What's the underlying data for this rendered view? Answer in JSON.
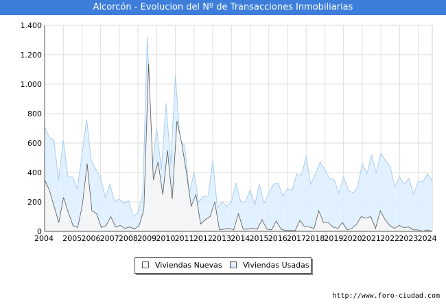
{
  "chart_data": {
    "type": "area",
    "title": "Alcorcón - Evolucion del Nº de Transacciones Inmobiliarias",
    "xlabel": "",
    "ylabel": "",
    "ylim": [
      0,
      1400
    ],
    "yticks": [
      0,
      200,
      400,
      600,
      800,
      1000,
      1200,
      1400
    ],
    "ytick_labels": [
      "0",
      "200",
      "400",
      "600",
      "800",
      "1.000",
      "1.200",
      "1.400"
    ],
    "xlim": [
      2004,
      2024.75
    ],
    "xticks": [
      2004,
      2005,
      2006,
      2007,
      2008,
      2009,
      2010,
      2011,
      2012,
      2013,
      2014,
      2015,
      2016,
      2017,
      2018,
      2019,
      2020,
      2021,
      2022,
      2023,
      2024
    ],
    "xtick_labels": [
      "2004",
      "2005",
      "2006",
      "2007",
      "2008",
      "2009",
      "2010",
      "2011",
      "2012",
      "2013",
      "2014",
      "2015",
      "2016",
      "2017",
      "2018",
      "2019",
      "2020",
      "2021",
      "2022",
      "2023",
      "2024"
    ],
    "grid": true,
    "legend_position": "bottom-center",
    "colors": {
      "nuevas_fill": "#f5f5f5",
      "usadas_fill": "#ddeeff",
      "nuevas_line": "#555555",
      "usadas_line": "#a8cdee",
      "grid": "#dddddd"
    },
    "series": [
      {
        "name": "Viviendas Nuevas",
        "values": [
          350,
          280,
          170,
          60,
          230,
          130,
          40,
          25,
          180,
          460,
          140,
          120,
          25,
          40,
          100,
          30,
          40,
          20,
          30,
          15,
          40,
          150,
          1140,
          350,
          470,
          250,
          550,
          220,
          750,
          600,
          400,
          170,
          250,
          50,
          80,
          100,
          200,
          10,
          15,
          20,
          10,
          120,
          15,
          15,
          20,
          15,
          80,
          15,
          10,
          70,
          15,
          5,
          5,
          5,
          75,
          30,
          30,
          20,
          140,
          60,
          60,
          30,
          20,
          60,
          10,
          20,
          50,
          100,
          90,
          100,
          20,
          140,
          80,
          40,
          20,
          40,
          25,
          30,
          10,
          10,
          0,
          10,
          0
        ]
      },
      {
        "name": "Viviendas Usadas",
        "values": [
          710,
          640,
          620,
          350,
          620,
          370,
          370,
          290,
          520,
          760,
          480,
          420,
          360,
          230,
          320,
          200,
          220,
          190,
          210,
          100,
          130,
          250,
          1320,
          410,
          700,
          420,
          870,
          460,
          1060,
          620,
          580,
          260,
          400,
          200,
          240,
          240,
          480,
          160,
          200,
          170,
          200,
          330,
          200,
          200,
          280,
          180,
          320,
          190,
          260,
          320,
          330,
          240,
          290,
          280,
          390,
          380,
          510,
          320,
          390,
          470,
          420,
          360,
          350,
          260,
          370,
          280,
          260,
          300,
          460,
          390,
          520,
          400,
          530,
          480,
          440,
          300,
          370,
          320,
          360,
          250,
          340,
          340,
          390,
          340
        ]
      }
    ]
  },
  "footer": {
    "credit": "http://www.foro-ciudad.com"
  },
  "watermark": "FORO-CIUDAD.COM"
}
